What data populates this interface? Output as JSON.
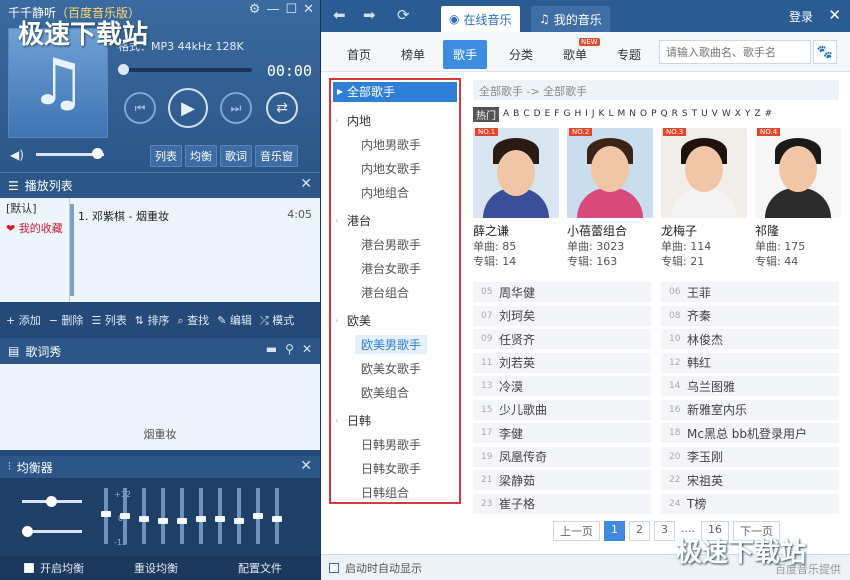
{
  "player": {
    "title": "千千静听",
    "edition": "（百度音乐版）",
    "format": "格式：MP3 44kHz 128K",
    "time": "00:00",
    "progress": 0,
    "volume": 0.9,
    "tabs": [
      "列表",
      "均衡",
      "歌词",
      "音乐窗"
    ]
  },
  "playlist": {
    "title": "播放列表",
    "lists": [
      "[默认]",
      "我的收藏"
    ],
    "track": "1. 邓紫棋 - 烟重妆",
    "duration": "4:05",
    "toolbar": [
      "+ 添加",
      "− 删除",
      "☰ 列表",
      "⇅ 排序",
      "⌕ 查找",
      "✎ 编辑",
      "⤮ 模式"
    ]
  },
  "lyrics": {
    "title": "歌词秀",
    "song": "烟重妆"
  },
  "equalizer": {
    "title": "均衡器",
    "labels": [
      "+12",
      "0",
      "-12"
    ],
    "levels": [
      0.55,
      0.5,
      0.45,
      0.4,
      0.4,
      0.45,
      0.45,
      0.4,
      0.5,
      0.45
    ],
    "enable": "开启均衡",
    "reset": "重设均衡",
    "config": "配置文件"
  },
  "topbar": {
    "tab_online": "在线音乐",
    "tab_mine": "我的音乐",
    "login": "登录"
  },
  "subnav": {
    "items": [
      "首页",
      "榜单",
      "歌手",
      "分类",
      "歌单",
      "专题"
    ],
    "new_badge": "NEW",
    "search_placeholder": "请输入歌曲名、歌手名"
  },
  "categories": {
    "all": "全部歌手",
    "groups": [
      {
        "name": "内地",
        "items": [
          "内地男歌手",
          "内地女歌手",
          "内地组合"
        ]
      },
      {
        "name": "港台",
        "items": [
          "港台男歌手",
          "港台女歌手",
          "港台组合"
        ]
      },
      {
        "name": "欧美",
        "items": [
          "欧美男歌手",
          "欧美女歌手",
          "欧美组合"
        ]
      },
      {
        "name": "日韩",
        "items": [
          "日韩男歌手",
          "日韩女歌手",
          "日韩组合"
        ]
      }
    ]
  },
  "breadcrumb": "全部歌手  -> 全部歌手",
  "alphabet": {
    "hot": "热门",
    "letters": [
      "A",
      "B",
      "C",
      "D",
      "E",
      "F",
      "G",
      "H",
      "I",
      "J",
      "K",
      "L",
      "M",
      "N",
      "O",
      "P",
      "Q",
      "R",
      "S",
      "T",
      "U",
      "V",
      "W",
      "X",
      "Y",
      "Z",
      "#"
    ]
  },
  "top_artists": [
    {
      "rank": "NO.1",
      "name": "薛之谦",
      "singles": "单曲: 85",
      "albums": "专辑: 14"
    },
    {
      "rank": "NO.2",
      "name": "小蓓蕾组合",
      "singles": "单曲: 3023",
      "albums": "专辑: 163"
    },
    {
      "rank": "NO.3",
      "name": "龙梅子",
      "singles": "单曲: 114",
      "albums": "专辑: 21"
    },
    {
      "rank": "NO.4",
      "name": "祁隆",
      "singles": "单曲: 175",
      "albums": "专辑: 44"
    }
  ],
  "ranked_list": [
    {
      "num": "05",
      "name": "周华健"
    },
    {
      "num": "06",
      "name": "王菲"
    },
    {
      "num": "07",
      "name": "刘珂矣"
    },
    {
      "num": "08",
      "name": "齐秦"
    },
    {
      "num": "09",
      "name": "任贤齐"
    },
    {
      "num": "10",
      "name": "林俊杰"
    },
    {
      "num": "11",
      "name": "刘若英"
    },
    {
      "num": "12",
      "name": "韩红"
    },
    {
      "num": "13",
      "name": "冷漠"
    },
    {
      "num": "14",
      "name": "乌兰图雅"
    },
    {
      "num": "15",
      "name": "少儿歌曲"
    },
    {
      "num": "16",
      "name": "新雅室内乐"
    },
    {
      "num": "17",
      "name": "李健"
    },
    {
      "num": "18",
      "name": "Mc黑总 bb机登录用户"
    },
    {
      "num": "19",
      "name": "凤凰传奇"
    },
    {
      "num": "20",
      "name": "李玉刚"
    },
    {
      "num": "21",
      "name": "梁静茹"
    },
    {
      "num": "22",
      "name": "宋祖英"
    },
    {
      "num": "23",
      "name": "崔子格"
    },
    {
      "num": "24",
      "name": "T榜"
    }
  ],
  "pager": {
    "prev": "上一页",
    "pages": [
      "1",
      "2",
      "3"
    ],
    "ellipsis": "....",
    "last": "16",
    "next": "下一页"
  },
  "status": {
    "autostart": "启动时自动显示",
    "provider": "百度音乐提供"
  },
  "watermark": "极速下载站",
  "colors": {
    "accent": "#3e8ce0",
    "panel": "#254a77",
    "highlight": "#d9363e"
  }
}
